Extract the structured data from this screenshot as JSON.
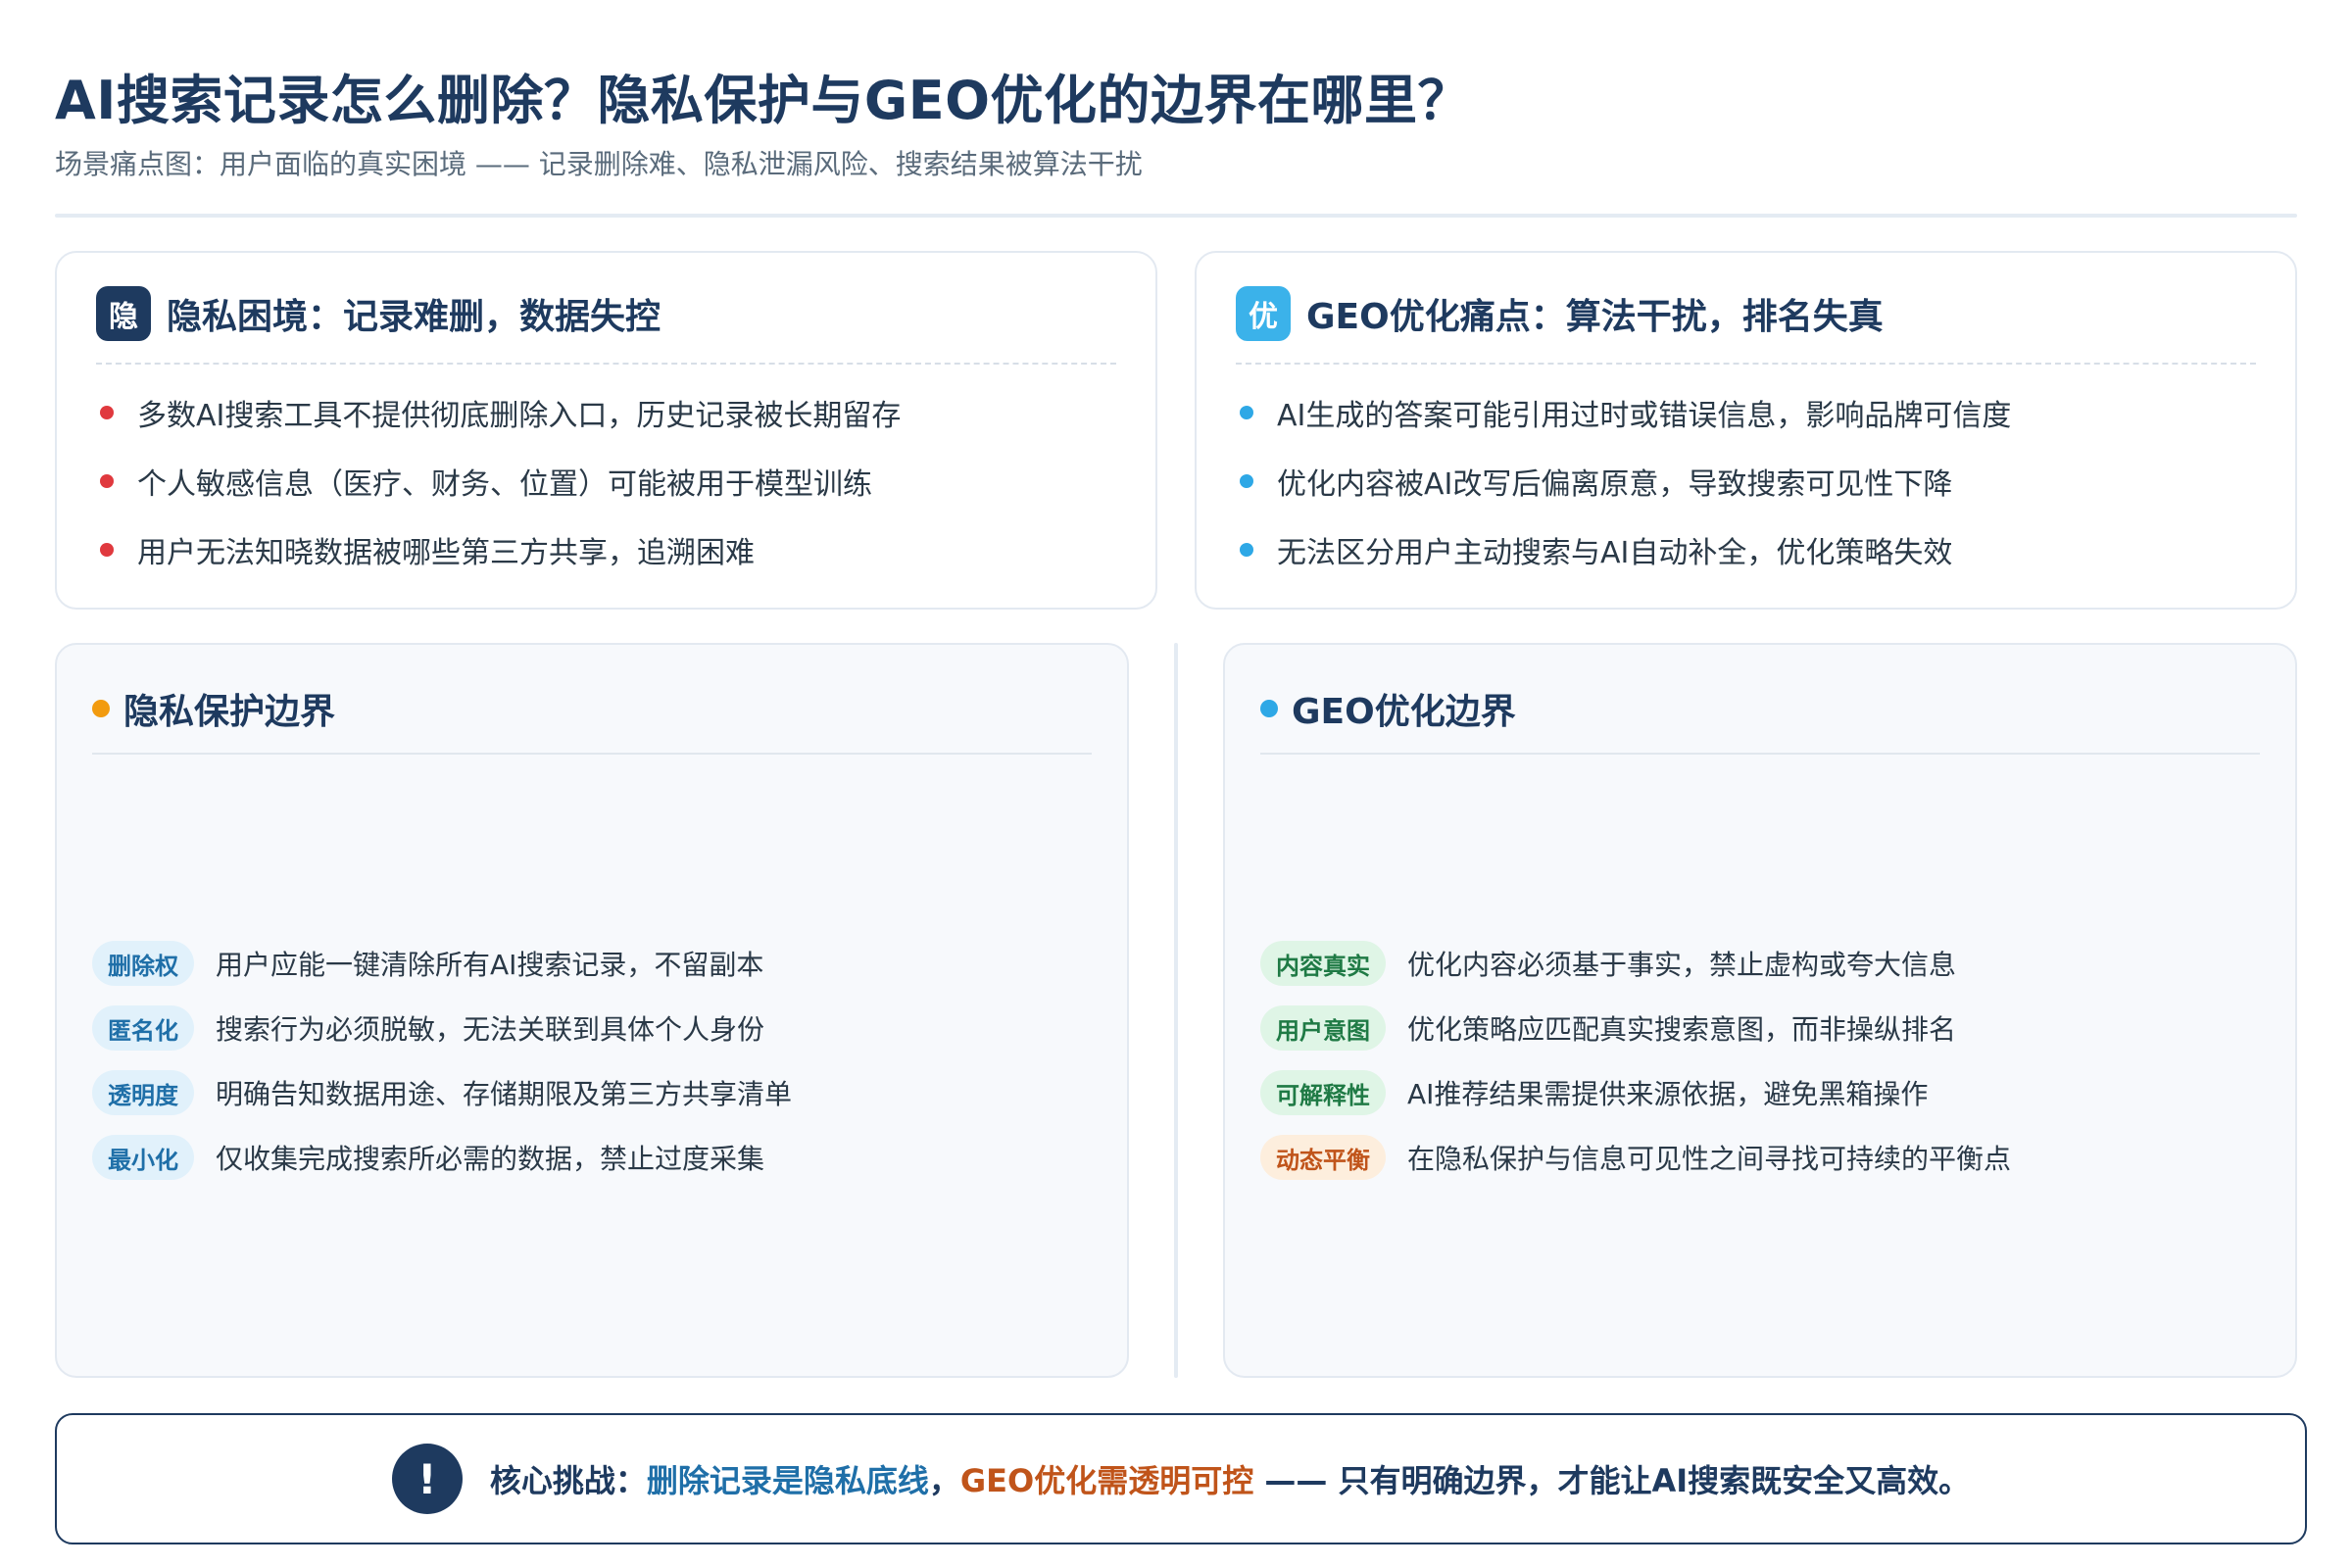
{
  "header": {
    "title": "AI搜索记录怎么删除？隐私保护与GEO优化的边界在哪里？",
    "subtitle": "场景痛点图：用户面临的真实困境 —— 记录删除难、隐私泄漏风险、搜索结果被算法干扰"
  },
  "colors": {
    "navy": "#1e3a5f",
    "red_bullet": "#e0393e",
    "blue_bullet": "#2ea8e6",
    "orange_dot": "#f29b0f",
    "accent_blue": "#1f6fa8",
    "accent_orange": "#c0541a"
  },
  "privacy_pain": {
    "badge": "隐",
    "badge_color": "#1e3a5f",
    "title": "隐私困境：记录难删，数据失控",
    "items": [
      "多数AI搜索工具不提供彻底删除入口，历史记录被长期留存",
      "个人敏感信息（医疗、财务、位置）可能被用于模型训练",
      "用户无法知晓数据被哪些第三方共享，追溯困难"
    ]
  },
  "geo_pain": {
    "badge": "优",
    "badge_color": "#3bb2ea",
    "title": "GEO优化痛点：算法干扰，排名失真",
    "items": [
      "AI生成的答案可能引用过时或错误信息，影响品牌可信度",
      "优化内容被AI改写后偏离原意，导致搜索可见性下降",
      "无法区分用户主动搜索与AI自动补全，优化策略失效"
    ]
  },
  "privacy_bounds": {
    "title": "隐私保护边界",
    "items": [
      {
        "tag": "删除权",
        "tag_style": "blue",
        "text": "用户应能一键清除所有AI搜索记录，不留副本"
      },
      {
        "tag": "匿名化",
        "tag_style": "blue",
        "text": "搜索行为必须脱敏，无法关联到具体个人身份"
      },
      {
        "tag": "透明度",
        "tag_style": "blue",
        "text": "明确告知数据用途、存储期限及第三方共享清单"
      },
      {
        "tag": "最小化",
        "tag_style": "blue",
        "text": "仅收集完成搜索所必需的数据，禁止过度采集"
      }
    ]
  },
  "geo_bounds": {
    "title": "GEO优化边界",
    "items": [
      {
        "tag": "内容真实",
        "tag_style": "green",
        "text": "优化内容必须基于事实，禁止虚构或夸大信息"
      },
      {
        "tag": "用户意图",
        "tag_style": "green",
        "text": "优化策略应匹配真实搜索意图，而非操纵排名"
      },
      {
        "tag": "可解释性",
        "tag_style": "green",
        "text": "AI推荐结果需提供来源依据，避免黑箱操作"
      },
      {
        "tag": "动态平衡",
        "tag_style": "orange",
        "text": "在隐私保护与信息可见性之间寻找可持续的平衡点"
      }
    ]
  },
  "banner": {
    "icon": "!",
    "icon_name": "exclamation-icon",
    "prefix": "核心挑战：",
    "highlight_blue": "删除记录是隐私底线",
    "comma": "，",
    "highlight_orange": "GEO优化需透明可控",
    "suffix": " —— 只有明确边界，才能让AI搜索既安全又高效。"
  }
}
